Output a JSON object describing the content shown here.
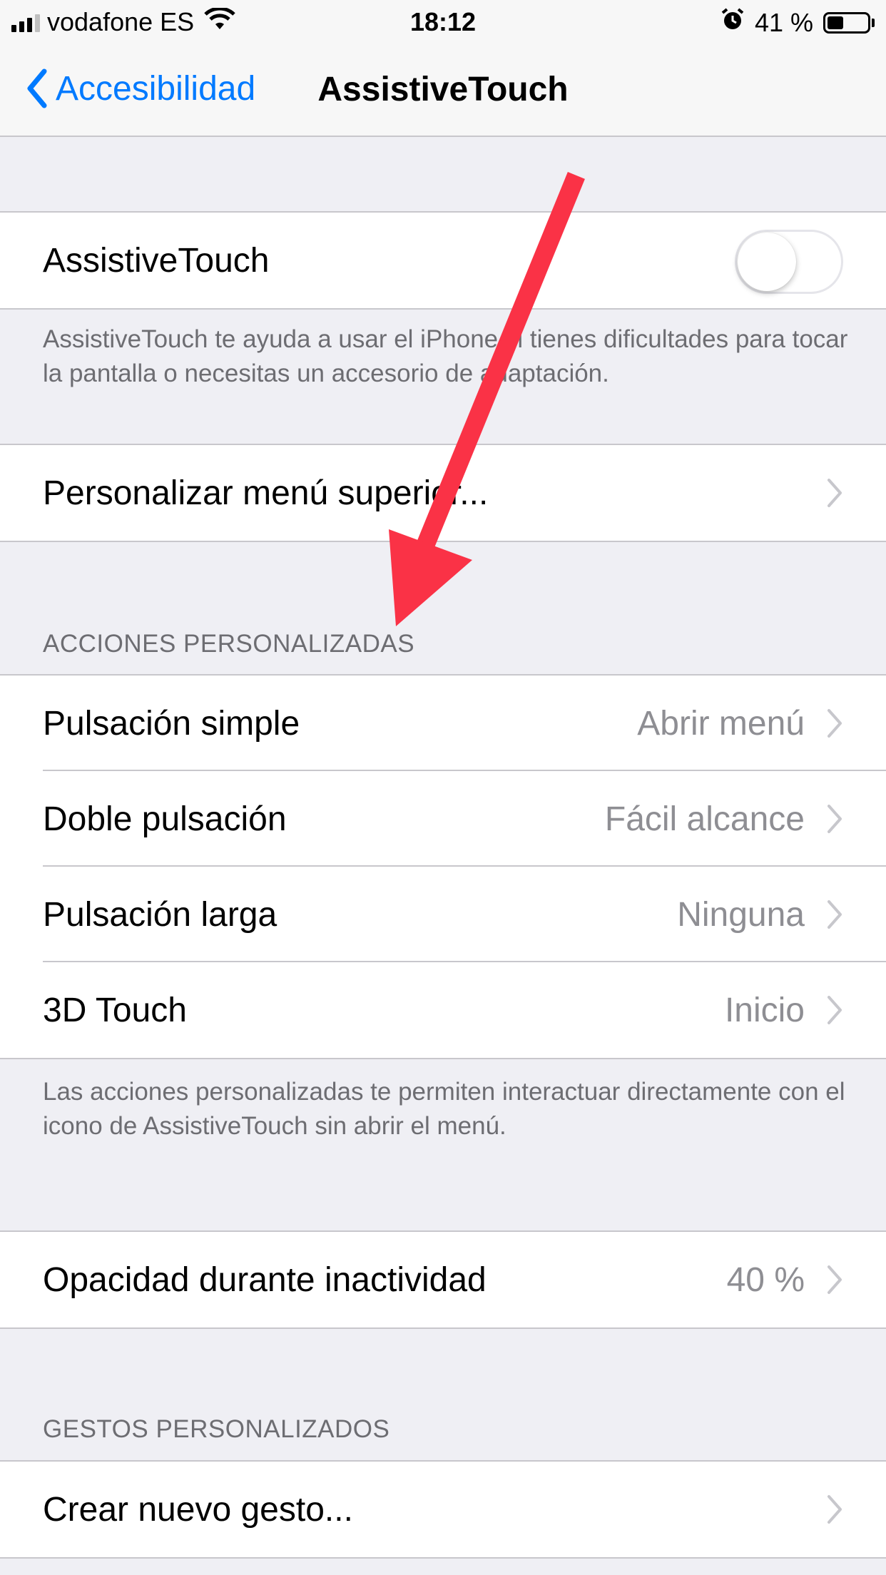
{
  "status_bar": {
    "carrier": "vodafone ES",
    "time": "18:12",
    "battery_percent": "41 %",
    "battery_level": 0.41,
    "icons": [
      "signal-icon",
      "wifi-icon",
      "alarm-icon",
      "battery-icon"
    ]
  },
  "nav": {
    "back_label": "Accesibilidad",
    "title": "AssistiveTouch"
  },
  "main_toggle": {
    "label": "AssistiveTouch",
    "on": false,
    "description": "AssistiveTouch te ayuda a usar el iPhone si tienes dificultades para tocar la pantalla o necesitas un accesorio de adaptación."
  },
  "customize_menu": {
    "label": "Personalizar menú superior..."
  },
  "custom_actions": {
    "header": "ACCIONES PERSONALIZADAS",
    "items": [
      {
        "label": "Pulsación simple",
        "value": "Abrir menú"
      },
      {
        "label": "Doble pulsación",
        "value": "Fácil alcance"
      },
      {
        "label": "Pulsación larga",
        "value": "Ninguna"
      },
      {
        "label": "3D Touch",
        "value": "Inicio"
      }
    ],
    "footer": "Las acciones personalizadas te permiten interactuar directamente con el icono de AssistiveTouch sin abrir el menú."
  },
  "idle_opacity": {
    "label": "Opacidad durante inactividad",
    "value": "40 %"
  },
  "custom_gestures": {
    "header": "GESTOS PERSONALIZADOS",
    "create_label": "Crear nuevo gesto..."
  },
  "colors": {
    "accent": "#007AFF",
    "annotation_arrow": "#FA3246",
    "background": "#EFEFF4",
    "secondary_text": "#8E8E93"
  }
}
